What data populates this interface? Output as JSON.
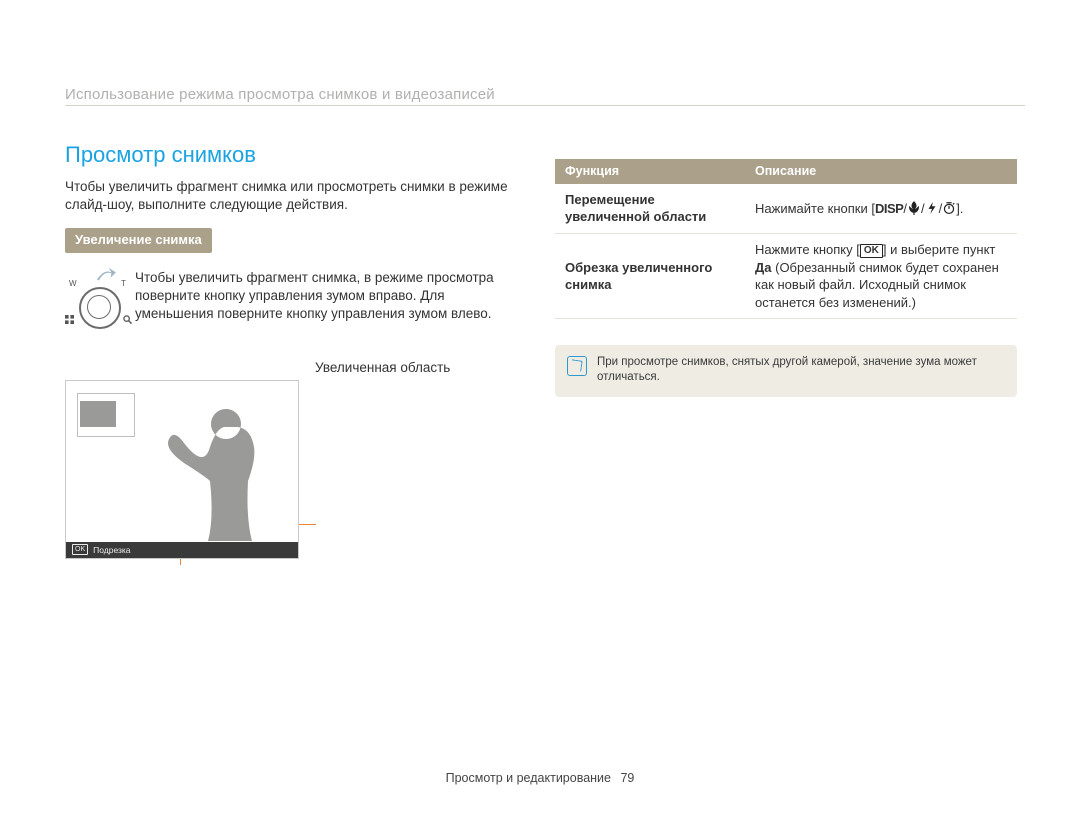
{
  "header": {
    "breadcrumb": "Использование режима просмотра снимков и видеозаписей"
  },
  "left": {
    "title": "Просмотр снимков",
    "intro": "Чтобы увеличить фрагмент снимка или просмотреть снимки в режиме слайд-шоу, выполните следующие действия.",
    "subheading": "Увеличение снимка",
    "dial": {
      "w": "W",
      "t": "T"
    },
    "zoom_text": "Чтобы увеличить фрагмент снимка, в режиме просмотра поверните кнопку управления зумом вправо. Для уменьшения поверните кнопку управления зумом влево.",
    "callout_label": "Увеличенная область",
    "preview_footer_ok": "OK",
    "preview_footer_text": "Подрезка"
  },
  "table": {
    "head_func": "Функция",
    "head_desc": "Описание",
    "rows": [
      {
        "func": "Перемещение увеличенной области",
        "desc_prefix": "Нажимайте кнопки [",
        "disp": "DISP",
        "desc_suffix": "]."
      },
      {
        "func": "Обрезка увеличенного снимка",
        "desc_prefix": "Нажмите кнопку [",
        "ok": "OK",
        "desc_mid": "] и выберите пункт ",
        "yes": "Да",
        "desc_suffix": " (Обрезанный снимок будет сохранен как новый файл. Исходный снимок останется без изменений.)"
      }
    ]
  },
  "note": {
    "text": "При просмотре снимков, снятых другой камерой, значение зума может отличаться."
  },
  "footer": {
    "section": "Просмотр и редактирование",
    "page": "79"
  }
}
